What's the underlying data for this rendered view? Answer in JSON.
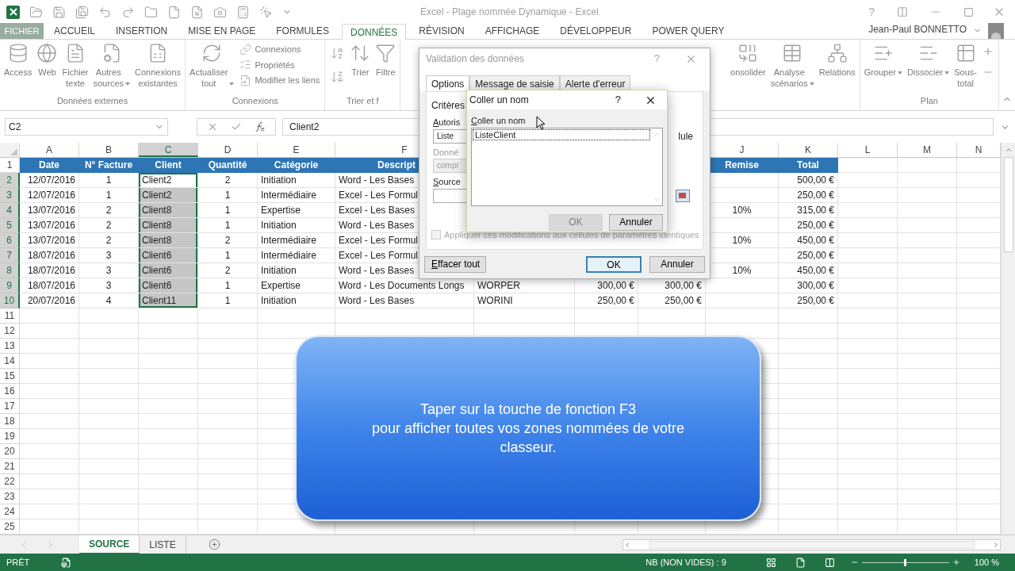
{
  "window": {
    "title": "Excel - Plage nommée Dynamique - Excel",
    "help": "?"
  },
  "ribbon_tabs": [
    {
      "label": "FICHIER",
      "kind": "file",
      "selected": false
    },
    {
      "label": "ACCUEIL",
      "kind": "tab",
      "selected": false
    },
    {
      "label": "INSERTION",
      "kind": "tab",
      "selected": false
    },
    {
      "label": "MISE EN PAGE",
      "kind": "tab",
      "selected": false
    },
    {
      "label": "FORMULES",
      "kind": "tab",
      "selected": false
    },
    {
      "label": "DONNÉES",
      "kind": "tab",
      "selected": true
    },
    {
      "label": "RÉVISION",
      "kind": "tab",
      "selected": false
    },
    {
      "label": "AFFICHAGE",
      "kind": "tab",
      "selected": false
    },
    {
      "label": "DÉVELOPPEUR",
      "kind": "tab",
      "selected": false
    },
    {
      "label": "POWER QUERY",
      "kind": "tab",
      "selected": false
    }
  ],
  "user": {
    "name": "Jean-Paul BONNETTO"
  },
  "ribbon_left": [
    {
      "label": "Données externes",
      "items": [
        {
          "kind": "large",
          "label": "Access"
        },
        {
          "kind": "large",
          "label": "Web"
        },
        {
          "kind": "large",
          "label": "Fichier\ntexte"
        },
        {
          "kind": "large",
          "label": "Autres\nsources",
          "dropdown": true
        },
        {
          "kind": "large",
          "label": "Connexions\nexistantes"
        }
      ]
    },
    {
      "label": "Connexions",
      "items": [
        {
          "kind": "large",
          "label": "Actualiser\ntout",
          "dropdown": true
        },
        {
          "kind": "small",
          "labels": [
            "Connexions",
            "Propriétés",
            "Modifier les liens"
          ]
        }
      ]
    },
    {
      "label": "Trier et f",
      "items": [
        {
          "kind": "sort"
        },
        {
          "kind": "large",
          "label": "Trier"
        },
        {
          "kind": "large",
          "label": "Filtre"
        }
      ]
    }
  ],
  "ribbon_right": [
    {
      "items": [
        {
          "kind": "large",
          "label": "onsolider"
        },
        {
          "kind": "large",
          "label": "Analyse\nscénarios",
          "dropdown": true
        },
        {
          "kind": "large",
          "label": "Relations"
        }
      ]
    },
    {
      "label": "Plan",
      "items": [
        {
          "kind": "large",
          "label": "Grouper",
          "dropdown": true
        },
        {
          "kind": "large",
          "label": "Dissocier",
          "dropdown": true
        },
        {
          "kind": "large",
          "label": "Sous-\ntotal"
        },
        {
          "kind": "plusminus"
        }
      ]
    }
  ],
  "formula_bar": {
    "name_box": "C2",
    "value": "Client2"
  },
  "columns": [
    {
      "label": "A",
      "selected": false
    },
    {
      "label": "B",
      "selected": false
    },
    {
      "label": "C",
      "selected": true
    },
    {
      "label": "D",
      "selected": false
    },
    {
      "label": "E",
      "selected": false
    },
    {
      "label": "F",
      "selected": false
    },
    null,
    null,
    null,
    {
      "label": "J",
      "selected": false
    },
    {
      "label": "K",
      "selected": false
    },
    {
      "label": "L",
      "selected": false
    },
    {
      "label": "M",
      "selected": false
    },
    {
      "label": "N",
      "selected": false
    }
  ],
  "rows": [
    {
      "number": "1",
      "kind": "header",
      "selected": false,
      "cells": [
        "Date",
        "N° Facture",
        "Client",
        "Quantité",
        "Catégorie",
        "Descript",
        null,
        null,
        null,
        "Remise",
        "Total",
        null,
        null,
        null
      ]
    },
    {
      "number": "2",
      "kind": "data",
      "selected": true,
      "cells": [
        "12/07/2016",
        "1",
        "Client2",
        "2",
        "Initiation",
        "Word - Les Bases",
        null,
        null,
        null,
        null,
        "500,00 €",
        null,
        null,
        null
      ]
    },
    {
      "number": "3",
      "kind": "data",
      "selected": true,
      "cells": [
        "12/07/2016",
        "1",
        "Client2",
        "1",
        "Intermédiaire",
        "Excel - Les Formul",
        null,
        null,
        null,
        null,
        "250,00 €",
        null,
        null,
        null
      ]
    },
    {
      "number": "4",
      "kind": "data",
      "selected": true,
      "cells": [
        "13/07/2016",
        "2",
        "Client8",
        "1",
        "Expertise",
        "Excel - Les Bases",
        null,
        null,
        null,
        "10%",
        "315,00 €",
        null,
        null,
        null
      ]
    },
    {
      "number": "5",
      "kind": "data",
      "selected": true,
      "cells": [
        "13/07/2016",
        "2",
        "Client8",
        "1",
        "Initiation",
        "Word - Les Bases",
        null,
        null,
        null,
        null,
        "250,00 €",
        null,
        null,
        null
      ]
    },
    {
      "number": "6",
      "kind": "data",
      "selected": true,
      "cells": [
        "13/07/2016",
        "2",
        "Client8",
        "2",
        "Intermédiaire",
        "Excel - Les Formul",
        null,
        null,
        null,
        "10%",
        "450,00 €",
        null,
        null,
        null
      ]
    },
    {
      "number": "7",
      "kind": "data",
      "selected": true,
      "cells": [
        "18/07/2016",
        "3",
        "Client6",
        "1",
        "Intermédiaire",
        "Excel - Les Formul",
        null,
        null,
        null,
        null,
        "250,00 €",
        null,
        null,
        null
      ]
    },
    {
      "number": "8",
      "kind": "data",
      "selected": true,
      "cells": [
        "18/07/2016",
        "3",
        "Client6",
        "2",
        "Initiation",
        "Word - Les Bases",
        null,
        null,
        null,
        "10%",
        "450,00 €",
        null,
        null,
        null
      ]
    },
    {
      "number": "9",
      "kind": "data",
      "selected": true,
      "cells": [
        "18/07/2016",
        "3",
        "Client6",
        "1",
        "Expertise",
        "Word - Les Documents Longs",
        "WORPER",
        "300,00 €",
        "300,00 €",
        null,
        "300,00 €",
        null,
        null,
        null
      ]
    },
    {
      "number": "10",
      "kind": "data",
      "selected": true,
      "cells": [
        "20/07/2016",
        "4",
        "Client11",
        "1",
        "Initiation",
        "Word - Les Bases",
        "WORINI",
        "250,00 €",
        "250,00 €",
        null,
        "250,00 €",
        null,
        null,
        null
      ]
    },
    {
      "number": "11",
      "kind": "data",
      "selected": false
    },
    {
      "number": "12",
      "kind": "data",
      "selected": false
    },
    {
      "number": "13",
      "kind": "data",
      "selected": false
    },
    {
      "number": "14",
      "kind": "data",
      "selected": false
    },
    {
      "number": "15",
      "kind": "data",
      "selected": false
    },
    {
      "number": "16",
      "kind": "data",
      "selected": false
    },
    {
      "number": "17",
      "kind": "data",
      "selected": false
    },
    {
      "number": "18",
      "kind": "data",
      "selected": false
    },
    {
      "number": "19",
      "kind": "data",
      "selected": false
    },
    {
      "number": "20",
      "kind": "data",
      "selected": false
    },
    {
      "number": "21",
      "kind": "data",
      "selected": false
    },
    {
      "number": "22",
      "kind": "data",
      "selected": false
    },
    {
      "number": "23",
      "kind": "data",
      "selected": false
    },
    {
      "number": "24",
      "kind": "data",
      "selected": false
    },
    {
      "number": "25",
      "kind": "data",
      "selected": false
    }
  ],
  "validation_dialog": {
    "title": "Validation des données",
    "help": "?",
    "tabs": [
      {
        "label": "Options",
        "selected": true
      },
      {
        "label": "Message de saisie",
        "selected": false
      },
      {
        "label": "Alerte d'erreur",
        "selected": false
      }
    ],
    "criteria_label": "Critères",
    "allow_label": "Autoris",
    "allow_value": "Liste",
    "side_text": "lule",
    "data_label": {
      "text": "Donné",
      "disabled": true
    },
    "data_value": {
      "text": "compr",
      "disabled": true
    },
    "source_label": "Source",
    "apply_checkbox": {
      "label": "Appliquer ces modifications aux cellules de paramètres identiques",
      "checked": false,
      "disabled": true
    },
    "buttons": [
      {
        "label": "Effacer tout",
        "default": false
      },
      {
        "label": "OK",
        "default": true
      },
      {
        "label": "Annuler",
        "default": false
      }
    ]
  },
  "paste_name_dialog": {
    "title": "Coller un nom",
    "help": "?",
    "list_label": "Coller un nom",
    "names": [
      {
        "label": "ListeClient",
        "selected": true
      }
    ],
    "buttons": [
      {
        "label": "OK",
        "disabled": true
      },
      {
        "label": "Annuler",
        "disabled": false
      }
    ]
  },
  "callout": {
    "text": "Taper sur la touche de fonction F3\npour afficher toutes vos zones nommées de votre\nclasseur."
  },
  "sheet_tabs": [
    {
      "label": "SOURCE",
      "selected": true
    },
    {
      "label": "LISTE",
      "selected": false
    }
  ],
  "status_bar": {
    "mode": "PRÊT",
    "count": "NB (NON VIDES) : 9",
    "zoom": {
      "level": 0.5,
      "label": "100 %"
    }
  }
}
